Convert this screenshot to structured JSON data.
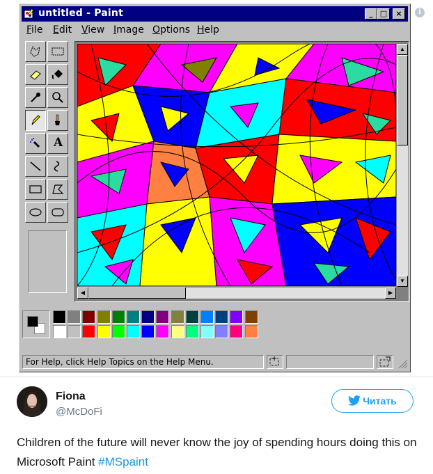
{
  "window": {
    "title": "untitled - Paint",
    "controls": {
      "minimize": "_",
      "maximize": "□",
      "close": "×"
    }
  },
  "menu": [
    {
      "key": "F",
      "rest": "ile"
    },
    {
      "key": "E",
      "rest": "dit"
    },
    {
      "key": "V",
      "rest": "iew"
    },
    {
      "key": "I",
      "rest": "mage"
    },
    {
      "key": "O",
      "rest": "ptions"
    },
    {
      "key": "H",
      "rest": "elp"
    }
  ],
  "toolbox": {
    "tools": [
      "free-form-select",
      "select",
      "eraser",
      "fill-with-color",
      "pick-color",
      "magnifier",
      "pencil",
      "brush",
      "airbrush",
      "text",
      "line",
      "curve",
      "rectangle",
      "polygon",
      "ellipse",
      "rounded-rectangle"
    ],
    "active_tool": "pencil",
    "text_tool_glyph": "A"
  },
  "palette": {
    "foreground": "#000000",
    "background": "#ffffff",
    "row1": [
      "#000000",
      "#808080",
      "#800000",
      "#808000",
      "#008000",
      "#008080",
      "#000080",
      "#800080",
      "#808040",
      "#004040",
      "#0080ff",
      "#004080",
      "#8000ff",
      "#804000"
    ],
    "row2": [
      "#ffffff",
      "#c0c0c0",
      "#ff0000",
      "#ffff00",
      "#00ff00",
      "#00ffff",
      "#0000ff",
      "#ff00ff",
      "#ffff80",
      "#00ff80",
      "#80ffff",
      "#8080ff",
      "#ff0080",
      "#ff8040"
    ]
  },
  "status": {
    "help_text": "For Help, click Help Topics on the Help Menu."
  },
  "tweet": {
    "author_name": "Fiona",
    "author_handle": "@McDoFi",
    "follow_label": "Читать",
    "text": "Children of the future will never know the joy of spending hours doing this on Microsoft Paint ",
    "hashtag": "#MSpaint"
  },
  "colors": {
    "titlebar": "#000080",
    "window_face": "#c0c0c0",
    "twitter_blue": "#1da1f2"
  }
}
